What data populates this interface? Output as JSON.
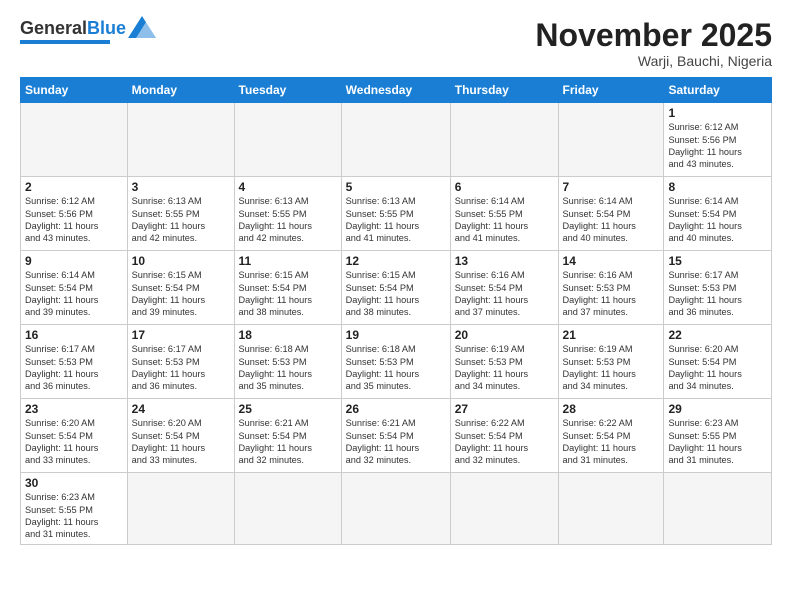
{
  "logo": {
    "text_general": "General",
    "text_blue": "Blue"
  },
  "header": {
    "title": "November 2025",
    "location": "Warji, Bauchi, Nigeria"
  },
  "weekdays": [
    "Sunday",
    "Monday",
    "Tuesday",
    "Wednesday",
    "Thursday",
    "Friday",
    "Saturday"
  ],
  "weeks": [
    [
      {
        "day": "",
        "info": ""
      },
      {
        "day": "",
        "info": ""
      },
      {
        "day": "",
        "info": ""
      },
      {
        "day": "",
        "info": ""
      },
      {
        "day": "",
        "info": ""
      },
      {
        "day": "",
        "info": ""
      },
      {
        "day": "1",
        "info": "Sunrise: 6:12 AM\nSunset: 5:56 PM\nDaylight: 11 hours\nand 43 minutes."
      }
    ],
    [
      {
        "day": "2",
        "info": "Sunrise: 6:12 AM\nSunset: 5:56 PM\nDaylight: 11 hours\nand 43 minutes."
      },
      {
        "day": "3",
        "info": "Sunrise: 6:13 AM\nSunset: 5:55 PM\nDaylight: 11 hours\nand 42 minutes."
      },
      {
        "day": "4",
        "info": "Sunrise: 6:13 AM\nSunset: 5:55 PM\nDaylight: 11 hours\nand 42 minutes."
      },
      {
        "day": "5",
        "info": "Sunrise: 6:13 AM\nSunset: 5:55 PM\nDaylight: 11 hours\nand 41 minutes."
      },
      {
        "day": "6",
        "info": "Sunrise: 6:14 AM\nSunset: 5:55 PM\nDaylight: 11 hours\nand 41 minutes."
      },
      {
        "day": "7",
        "info": "Sunrise: 6:14 AM\nSunset: 5:54 PM\nDaylight: 11 hours\nand 40 minutes."
      },
      {
        "day": "8",
        "info": "Sunrise: 6:14 AM\nSunset: 5:54 PM\nDaylight: 11 hours\nand 40 minutes."
      }
    ],
    [
      {
        "day": "9",
        "info": "Sunrise: 6:14 AM\nSunset: 5:54 PM\nDaylight: 11 hours\nand 39 minutes."
      },
      {
        "day": "10",
        "info": "Sunrise: 6:15 AM\nSunset: 5:54 PM\nDaylight: 11 hours\nand 39 minutes."
      },
      {
        "day": "11",
        "info": "Sunrise: 6:15 AM\nSunset: 5:54 PM\nDaylight: 11 hours\nand 38 minutes."
      },
      {
        "day": "12",
        "info": "Sunrise: 6:15 AM\nSunset: 5:54 PM\nDaylight: 11 hours\nand 38 minutes."
      },
      {
        "day": "13",
        "info": "Sunrise: 6:16 AM\nSunset: 5:54 PM\nDaylight: 11 hours\nand 37 minutes."
      },
      {
        "day": "14",
        "info": "Sunrise: 6:16 AM\nSunset: 5:53 PM\nDaylight: 11 hours\nand 37 minutes."
      },
      {
        "day": "15",
        "info": "Sunrise: 6:17 AM\nSunset: 5:53 PM\nDaylight: 11 hours\nand 36 minutes."
      }
    ],
    [
      {
        "day": "16",
        "info": "Sunrise: 6:17 AM\nSunset: 5:53 PM\nDaylight: 11 hours\nand 36 minutes."
      },
      {
        "day": "17",
        "info": "Sunrise: 6:17 AM\nSunset: 5:53 PM\nDaylight: 11 hours\nand 36 minutes."
      },
      {
        "day": "18",
        "info": "Sunrise: 6:18 AM\nSunset: 5:53 PM\nDaylight: 11 hours\nand 35 minutes."
      },
      {
        "day": "19",
        "info": "Sunrise: 6:18 AM\nSunset: 5:53 PM\nDaylight: 11 hours\nand 35 minutes."
      },
      {
        "day": "20",
        "info": "Sunrise: 6:19 AM\nSunset: 5:53 PM\nDaylight: 11 hours\nand 34 minutes."
      },
      {
        "day": "21",
        "info": "Sunrise: 6:19 AM\nSunset: 5:53 PM\nDaylight: 11 hours\nand 34 minutes."
      },
      {
        "day": "22",
        "info": "Sunrise: 6:20 AM\nSunset: 5:54 PM\nDaylight: 11 hours\nand 34 minutes."
      }
    ],
    [
      {
        "day": "23",
        "info": "Sunrise: 6:20 AM\nSunset: 5:54 PM\nDaylight: 11 hours\nand 33 minutes."
      },
      {
        "day": "24",
        "info": "Sunrise: 6:20 AM\nSunset: 5:54 PM\nDaylight: 11 hours\nand 33 minutes."
      },
      {
        "day": "25",
        "info": "Sunrise: 6:21 AM\nSunset: 5:54 PM\nDaylight: 11 hours\nand 32 minutes."
      },
      {
        "day": "26",
        "info": "Sunrise: 6:21 AM\nSunset: 5:54 PM\nDaylight: 11 hours\nand 32 minutes."
      },
      {
        "day": "27",
        "info": "Sunrise: 6:22 AM\nSunset: 5:54 PM\nDaylight: 11 hours\nand 32 minutes."
      },
      {
        "day": "28",
        "info": "Sunrise: 6:22 AM\nSunset: 5:54 PM\nDaylight: 11 hours\nand 31 minutes."
      },
      {
        "day": "29",
        "info": "Sunrise: 6:23 AM\nSunset: 5:55 PM\nDaylight: 11 hours\nand 31 minutes."
      }
    ],
    [
      {
        "day": "30",
        "info": "Sunrise: 6:23 AM\nSunset: 5:55 PM\nDaylight: 11 hours\nand 31 minutes."
      },
      {
        "day": "",
        "info": ""
      },
      {
        "day": "",
        "info": ""
      },
      {
        "day": "",
        "info": ""
      },
      {
        "day": "",
        "info": ""
      },
      {
        "day": "",
        "info": ""
      },
      {
        "day": "",
        "info": ""
      }
    ]
  ]
}
